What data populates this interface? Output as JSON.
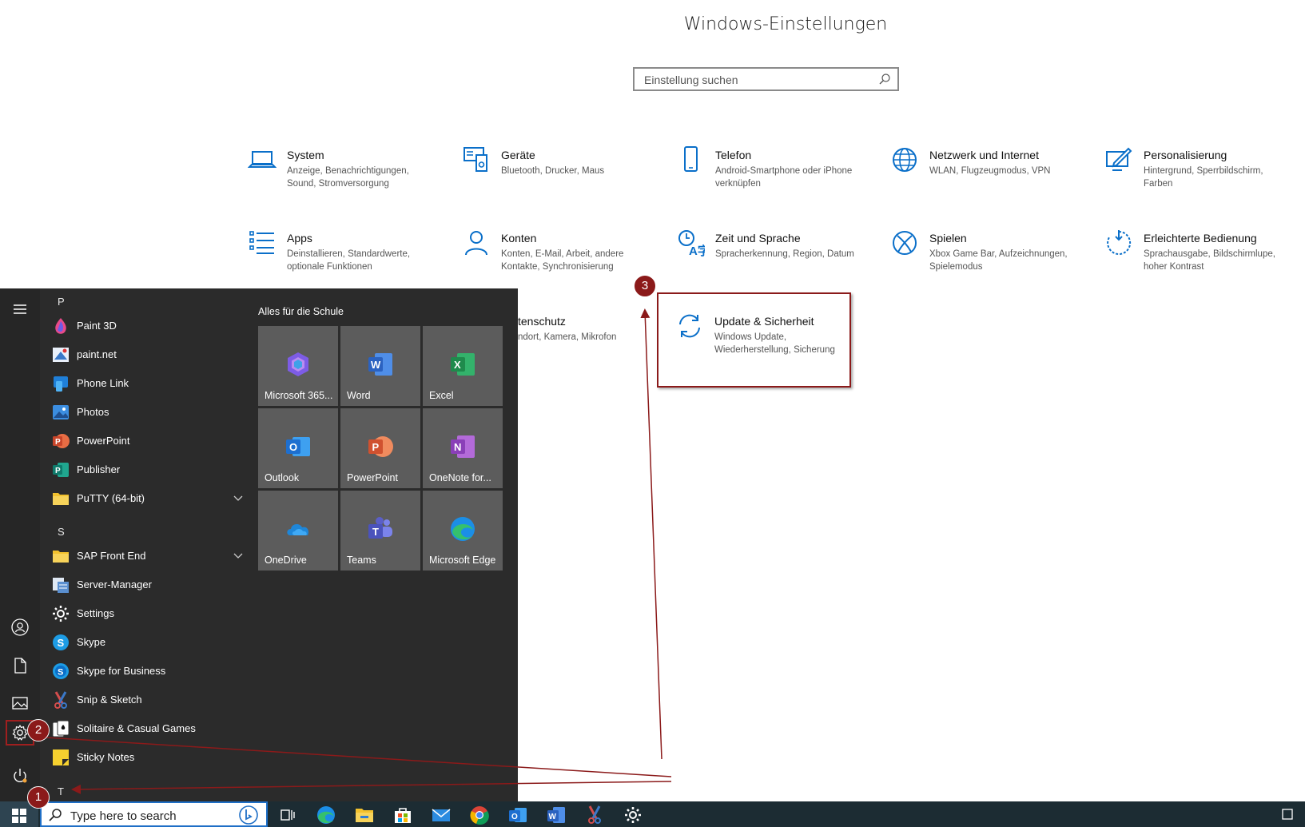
{
  "settings": {
    "title": "Windows-Einstellungen",
    "search_placeholder": "Einstellung suchen",
    "tiles": [
      {
        "title": "System",
        "desc": "Anzeige, Benachrichtigungen, Sound, Stromversorgung",
        "icon": "laptop-icon"
      },
      {
        "title": "Geräte",
        "desc": "Bluetooth, Drucker, Maus",
        "icon": "devices-icon"
      },
      {
        "title": "Telefon",
        "desc": "Android-Smartphone oder iPhone verknüpfen",
        "icon": "phone-icon"
      },
      {
        "title": "Netzwerk und Internet",
        "desc": "WLAN, Flugzeugmodus, VPN",
        "icon": "globe-icon"
      },
      {
        "title": "Personalisierung",
        "desc": "Hintergrund, Sperrbildschirm, Farben",
        "icon": "pen-screen-icon"
      },
      {
        "title": "Apps",
        "desc": "Deinstallieren, Standardwerte, optionale Funktionen",
        "icon": "apps-list-icon"
      },
      {
        "title": "Konten",
        "desc": "Konten, E-Mail, Arbeit, andere Kontakte, Synchronisierung",
        "icon": "person-icon"
      },
      {
        "title": "Zeit und Sprache",
        "desc": "Spracherkennung, Region, Datum",
        "icon": "time-language-icon"
      },
      {
        "title": "Spielen",
        "desc": "Xbox Game Bar, Aufzeichnungen, Spielemodus",
        "icon": "xbox-icon"
      },
      {
        "title": "Erleichterte Bedienung",
        "desc": "Sprachausgabe, Bildschirmlupe, hoher Kontrast",
        "icon": "ease-of-access-icon"
      },
      {
        "title": "tenschutz",
        "desc": "ndort, Kamera, Mikrofon",
        "icon": ""
      },
      {
        "title": "Update & Sicherheit",
        "desc": "Windows Update, Wiederherstellung, Sicherung",
        "icon": "sync-icon"
      }
    ]
  },
  "badges": {
    "one": "1",
    "two": "2",
    "three": "3"
  },
  "start_menu": {
    "letters": {
      "p": "P",
      "s": "S",
      "t": "T"
    },
    "apps": [
      {
        "name": "Paint 3D",
        "color": "#e84a8a"
      },
      {
        "name": "paint.net",
        "color": "#3a78c8"
      },
      {
        "name": "Phone Link",
        "color": "#1f7fd8"
      },
      {
        "name": "Photos",
        "color": "#3b8de0"
      },
      {
        "name": "PowerPoint",
        "color": "#c8452a"
      },
      {
        "name": "Publisher",
        "color": "#0f7b6c"
      },
      {
        "name": "PuTTY (64-bit)",
        "color": "#f2c12e"
      },
      {
        "name": "SAP Front End",
        "color": "#f2c12e"
      },
      {
        "name": "Server-Manager",
        "color": "#5a8fd0"
      },
      {
        "name": "Settings",
        "color": "#ffffff"
      },
      {
        "name": "Skype",
        "color": "#1d9ce5"
      },
      {
        "name": "Skype for Business",
        "color": "#1d9ce5"
      },
      {
        "name": "Snip & Sketch",
        "color": "#d44d4d"
      },
      {
        "name": "Solitaire & Casual Games",
        "color": "#ffffff"
      },
      {
        "name": "Sticky Notes",
        "color": "#f6d12f"
      }
    ],
    "tiles_heading": "Alles für die Schule",
    "tiles": [
      {
        "label": "Microsoft 365...",
        "color": "#7d5ce6"
      },
      {
        "label": "Word",
        "color": "#2b62c0"
      },
      {
        "label": "Excel",
        "color": "#1f8a4c"
      },
      {
        "label": "Outlook",
        "color": "#1d6fd0"
      },
      {
        "label": "PowerPoint",
        "color": "#d0512f"
      },
      {
        "label": "OneNote for...",
        "color": "#8a3fb8"
      },
      {
        "label": "OneDrive",
        "color": "#1e86d8"
      },
      {
        "label": "Teams",
        "color": "#5b5fc7"
      },
      {
        "label": "Microsoft Edge",
        "color": "#1da66e"
      }
    ]
  },
  "taskbar": {
    "search_placeholder": "Type here to search"
  }
}
